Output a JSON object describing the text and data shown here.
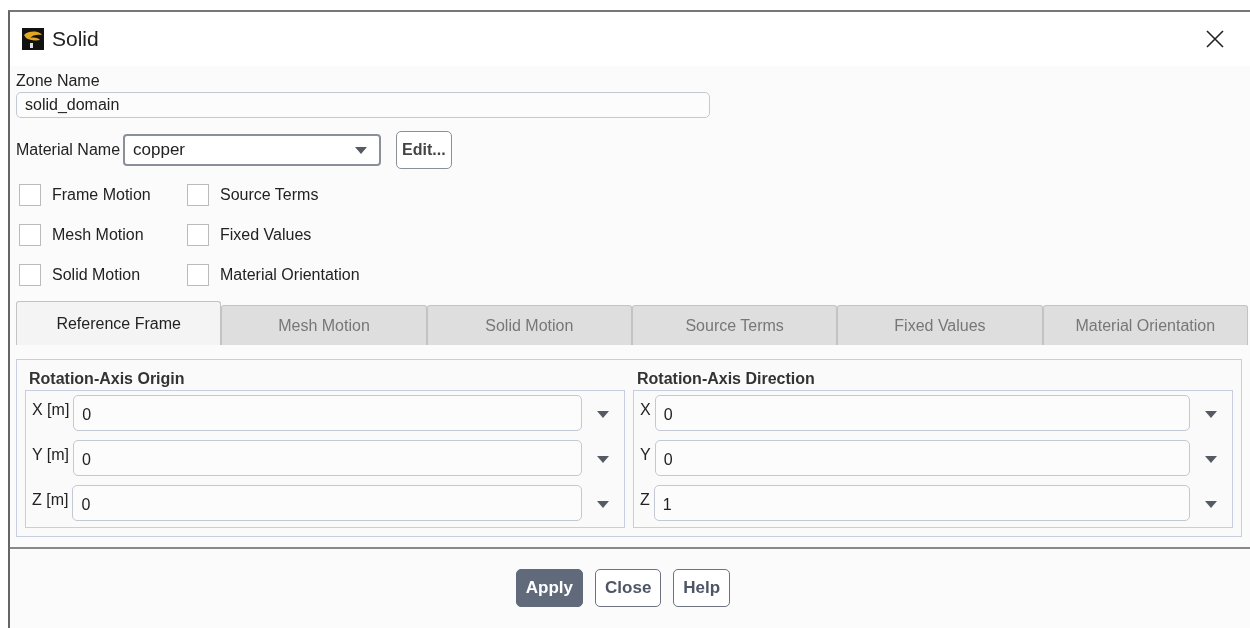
{
  "window": {
    "title": "Solid"
  },
  "zone_name": {
    "label": "Zone Name",
    "value": "solid_domain"
  },
  "material": {
    "label": "Material Name",
    "value": "copper",
    "edit_button": "Edit..."
  },
  "options": [
    {
      "label": "Frame Motion",
      "checked": false
    },
    {
      "label": "Source Terms",
      "checked": false
    },
    {
      "label": "Mesh Motion",
      "checked": false
    },
    {
      "label": "Fixed Values",
      "checked": false
    },
    {
      "label": "Solid Motion",
      "checked": false
    },
    {
      "label": "Material Orientation",
      "checked": false
    }
  ],
  "tabs": [
    {
      "label": "Reference Frame",
      "selected": true
    },
    {
      "label": "Mesh Motion",
      "selected": false
    },
    {
      "label": "Solid Motion",
      "selected": false
    },
    {
      "label": "Source Terms",
      "selected": false
    },
    {
      "label": "Fixed Values",
      "selected": false
    },
    {
      "label": "Material Orientation",
      "selected": false
    }
  ],
  "groups": [
    {
      "title": "Rotation-Axis Origin",
      "fields": [
        {
          "label": "X [m]",
          "value": "0"
        },
        {
          "label": "Y [m]",
          "value": "0"
        },
        {
          "label": "Z [m]",
          "value": "0"
        }
      ]
    },
    {
      "title": "Rotation-Axis Direction",
      "fields": [
        {
          "label": "X",
          "value": "0"
        },
        {
          "label": "Y",
          "value": "0"
        },
        {
          "label": "Z",
          "value": "1"
        }
      ]
    }
  ],
  "buttons": [
    {
      "label": "Apply",
      "kind": "primary"
    },
    {
      "label": "Close",
      "kind": "default"
    },
    {
      "label": "Help",
      "kind": "default"
    }
  ]
}
